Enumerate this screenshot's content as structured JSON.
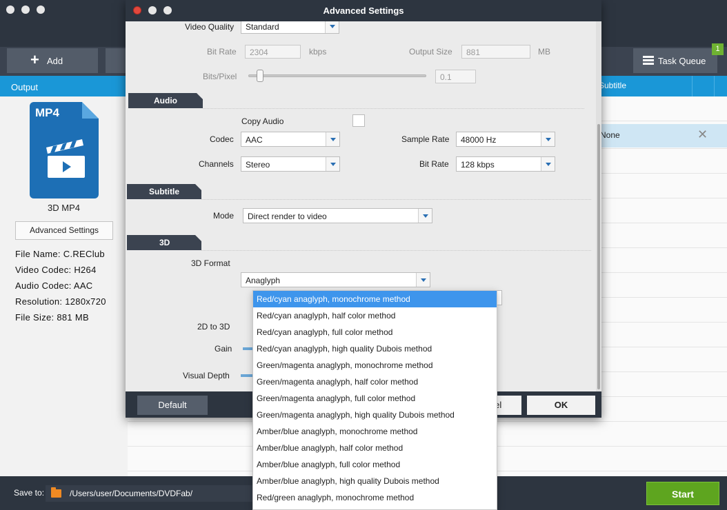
{
  "app": {
    "toolbar": {
      "add_label": "Add",
      "task_queue_label": "Task Queue",
      "task_queue_badge": "1"
    },
    "left": {
      "output_header": "Output",
      "profile_badge": "MP4",
      "profile_name": "3D MP4",
      "advanced_settings_label": "Advanced Settings",
      "info": [
        "File Name: C.REClub",
        "Video Codec: H264",
        "Audio Codec: AAC",
        "Resolution: 1280x720",
        "File Size: 881 MB"
      ]
    },
    "table": {
      "subtitle_header": "Subtitle",
      "row_text": "None"
    },
    "bottom": {
      "save_to_label": "Save to:",
      "path": "/Users/user/Documents/DVDFab/",
      "start_label": "Start"
    }
  },
  "dialog": {
    "title": "Advanced Settings",
    "video": {
      "quality_label": "Video Quality",
      "quality_value": "Standard",
      "bitrate_label": "Bit Rate",
      "bitrate_value": "2304",
      "bitrate_unit": "kbps",
      "output_size_label": "Output Size",
      "output_size_value": "881",
      "output_size_unit": "MB",
      "bits_pixel_label": "Bits/Pixel",
      "bits_pixel_value": "0.1",
      "bits_pixel_level": 0.05
    },
    "audio": {
      "section_title": "Audio",
      "copy_audio_label": "Copy Audio",
      "codec_label": "Codec",
      "codec_value": "AAC",
      "sample_rate_label": "Sample Rate",
      "sample_rate_value": "48000 Hz",
      "channels_label": "Channels",
      "channels_value": "Stereo",
      "bitrate_label": "Bit Rate",
      "bitrate_value": "128 kbps"
    },
    "subtitle": {
      "section_title": "Subtitle",
      "mode_label": "Mode",
      "mode_value": "Direct render to video"
    },
    "three_d": {
      "section_title": "3D",
      "format_label": "3D Format",
      "format_value": "Anaglyph",
      "two_d_label": "2D to 3D",
      "gain_label": "Gain",
      "visual_depth_label": "Visual Depth"
    },
    "footer": {
      "default_label": "Default",
      "cancel_label": "Cancel",
      "ok_label": "OK"
    }
  },
  "dropdown": {
    "selected_index": 0,
    "options": [
      "Red/cyan anaglyph, monochrome method",
      "Red/cyan anaglyph, half color method",
      "Red/cyan anaglyph, full color method",
      "Red/cyan anaglyph, high quality Dubois method",
      "Green/magenta anaglyph, monochrome method",
      "Green/magenta anaglyph, half color method",
      "Green/magenta anaglyph, full color method",
      "Green/magenta anaglyph, high quality Dubois method",
      "Amber/blue anaglyph, monochrome method",
      "Amber/blue anaglyph, half color method",
      "Amber/blue anaglyph, full color method",
      "Amber/blue anaglyph, high quality Dubois method",
      "Red/green anaglyph, monochrome method"
    ]
  },
  "colors": {
    "accent": "#1a97d7",
    "start": "#5ea51f",
    "selection": "#3e95ec",
    "dark": "#2d3540"
  },
  "icons": [
    "close-icon",
    "minimize-icon",
    "zoom-icon",
    "plus-icon",
    "list-icon",
    "remove-icon",
    "folder-icon",
    "clapperboard-icon",
    "chevron-down-icon"
  ]
}
